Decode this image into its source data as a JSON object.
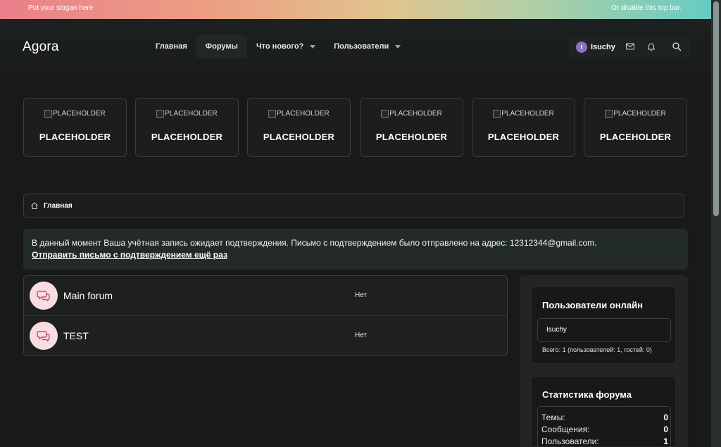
{
  "topbar": {
    "slogan": "Put your slogan here",
    "disable_text": "Or disable this top bar."
  },
  "header": {
    "logo": "Agora",
    "nav": [
      {
        "label": "Главная",
        "active": false,
        "has_dropdown": false
      },
      {
        "label": "Форумы",
        "active": true,
        "has_dropdown": false
      },
      {
        "label": "Что нового?",
        "active": false,
        "has_dropdown": true
      },
      {
        "label": "Пользователи",
        "active": false,
        "has_dropdown": true
      }
    ],
    "user": {
      "initial": "I",
      "name": "Isuchy"
    },
    "icons": [
      "envelope-icon",
      "bell-icon",
      "search-icon"
    ]
  },
  "banners": [
    {
      "img_alt": "PLACEHOLDER",
      "title": "PLACEHOLDER"
    },
    {
      "img_alt": "PLACEHOLDER",
      "title": "PLACEHOLDER"
    },
    {
      "img_alt": "PLACEHOLDER",
      "title": "PLACEHOLDER"
    },
    {
      "img_alt": "PLACEHOLDER",
      "title": "PLACEHOLDER"
    },
    {
      "img_alt": "PLACEHOLDER",
      "title": "PLACEHOLDER"
    },
    {
      "img_alt": "PLACEHOLDER",
      "title": "PLACEHOLDER"
    }
  ],
  "breadcrumb": {
    "home_label": "Главная"
  },
  "notice": {
    "text": "В данный момент Ваша учётная запись ожидает подтверждения. Письмо с подтверждением было отправлено на адрес: 12312344@gmail.com.",
    "link": "Отправить письмо с подтверждением ещё раз"
  },
  "forums": [
    {
      "title": "Main forum",
      "latest": "Нет"
    },
    {
      "title": "TEST",
      "latest": "Нет"
    }
  ],
  "sidebar": {
    "online": {
      "title": "Пользователи онлайн",
      "users": [
        "Isuchy"
      ],
      "total": "Всего: 1 (пользователей: 1, гостей: 0)"
    },
    "stats": {
      "title": "Статистика форума",
      "rows": [
        {
          "label": "Темы:",
          "value": "0"
        },
        {
          "label": "Сообщения:",
          "value": "0"
        },
        {
          "label": "Пользователи:",
          "value": "1"
        }
      ]
    }
  },
  "colors": {
    "background": "#181a1a",
    "forum_icon_bg": "#f7dde2",
    "forum_icon_fg": "#c94a62",
    "avatar": "#8c6fc1",
    "notice_bg": "#232a2a"
  }
}
